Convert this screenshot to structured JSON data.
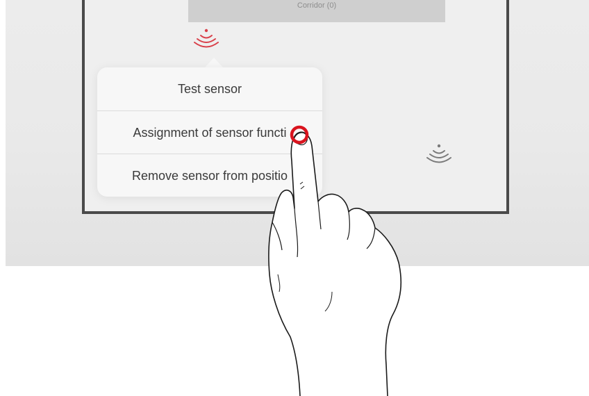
{
  "room": {
    "label": "Corridor (0)"
  },
  "menu": {
    "items": [
      {
        "label": "Test sensor"
      },
      {
        "label": "Assignment of sensor functi"
      },
      {
        "label": "Remove sensor from positio"
      }
    ]
  },
  "icons": {
    "sensor_active": "sensor-wifi-icon",
    "sensor_inactive": "sensor-wifi-icon",
    "touch": "tap-indicator-icon",
    "hand": "pointing-hand-icon"
  },
  "colors": {
    "active_sensor": "#d9404a",
    "inactive_sensor": "#7a7a7a",
    "tap_ring": "#d9141e",
    "wall": "#4a4a4a"
  }
}
